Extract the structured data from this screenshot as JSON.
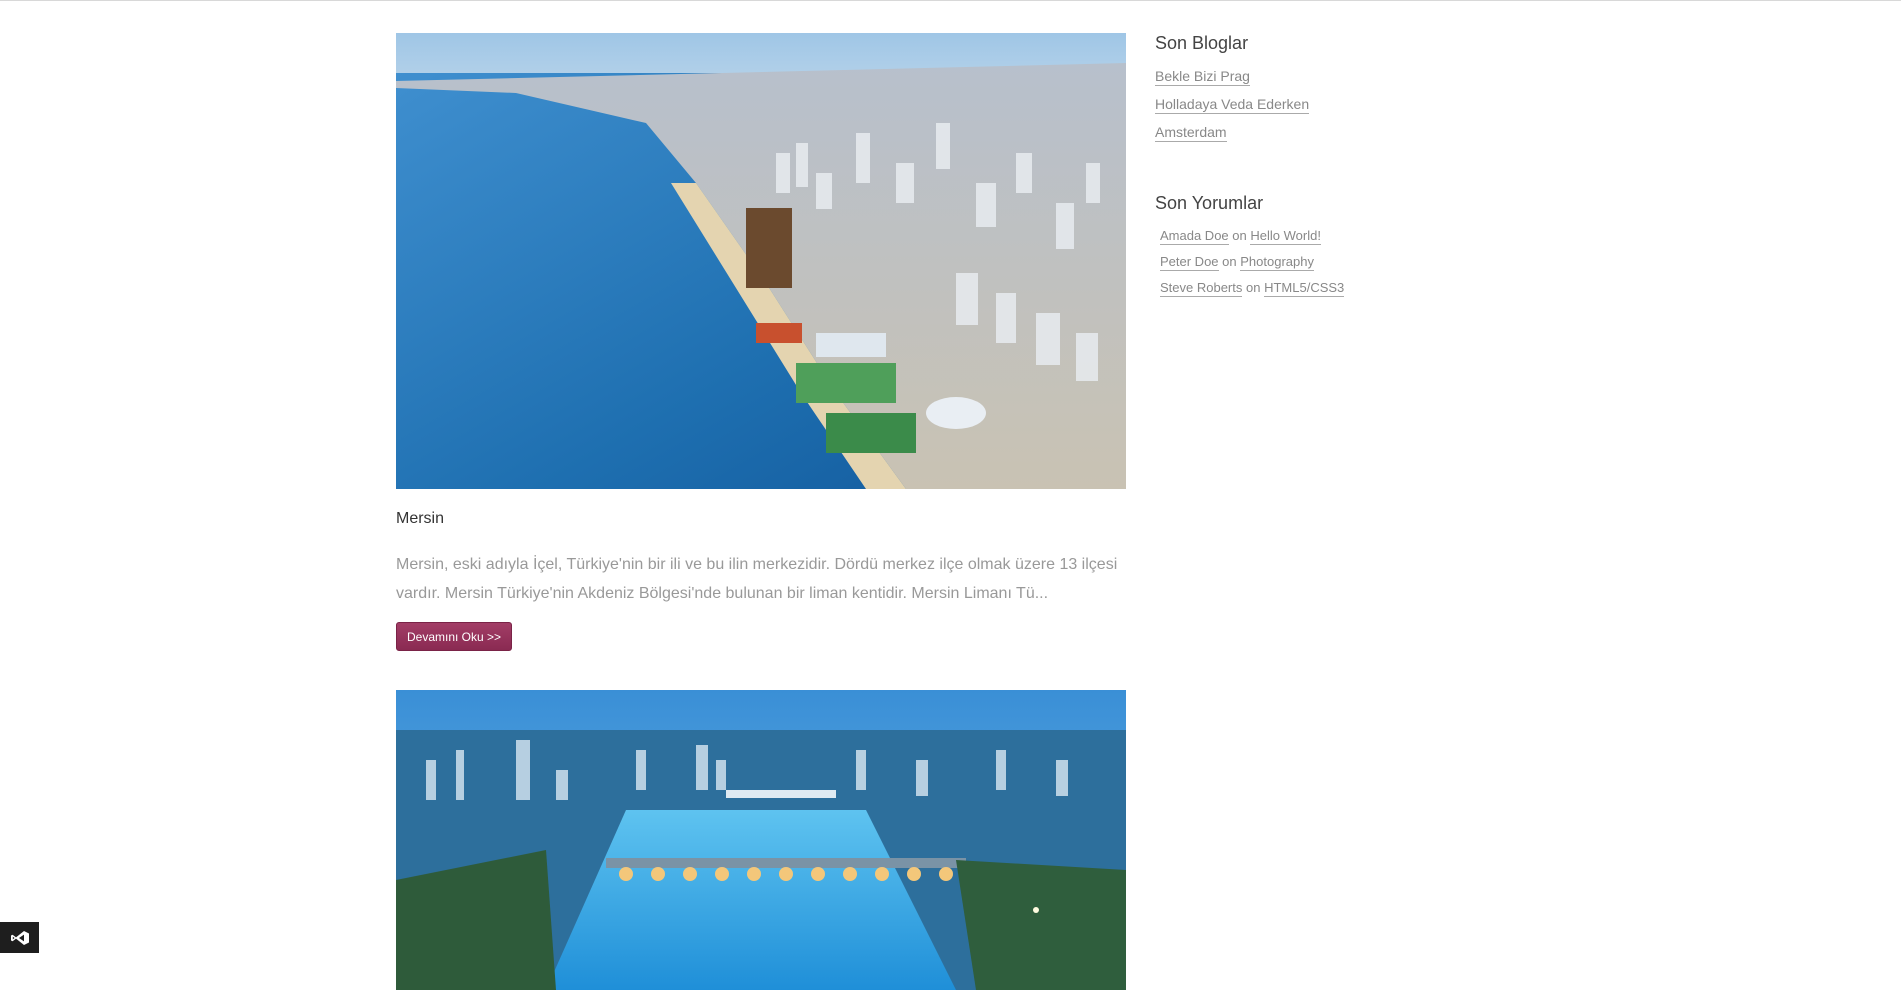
{
  "posts": [
    {
      "title": "Mersin",
      "excerpt": "Mersin, eski adıyla İçel, Türkiye'nin bir ili ve bu ilin merkezidir. Dördü merkez ilçe olmak üzere 13 ilçesi vardır. Mersin Türkiye'nin Akdeniz Bölgesi'nde bulunan bir liman kentidir. Mersin Limanı Tü...",
      "read_more": "Devamını Oku >>"
    }
  ],
  "sidebar": {
    "recent_blogs": {
      "title": "Son Bloglar",
      "items": [
        "Bekle Bizi Prag",
        "Holladaya Veda Ederken",
        "Amsterdam"
      ]
    },
    "recent_comments": {
      "title": "Son Yorumlar",
      "connector": "on",
      "items": [
        {
          "author": "Amada Doe",
          "post": "Hello World!"
        },
        {
          "author": "Peter Doe",
          "post": "Photography"
        },
        {
          "author": "Steve Roberts",
          "post": "HTML5/CSS3"
        }
      ]
    }
  },
  "colors": {
    "accent": "#96335c",
    "link": "#888888"
  },
  "icons": {
    "corner_badge": "visual-studio-icon"
  }
}
